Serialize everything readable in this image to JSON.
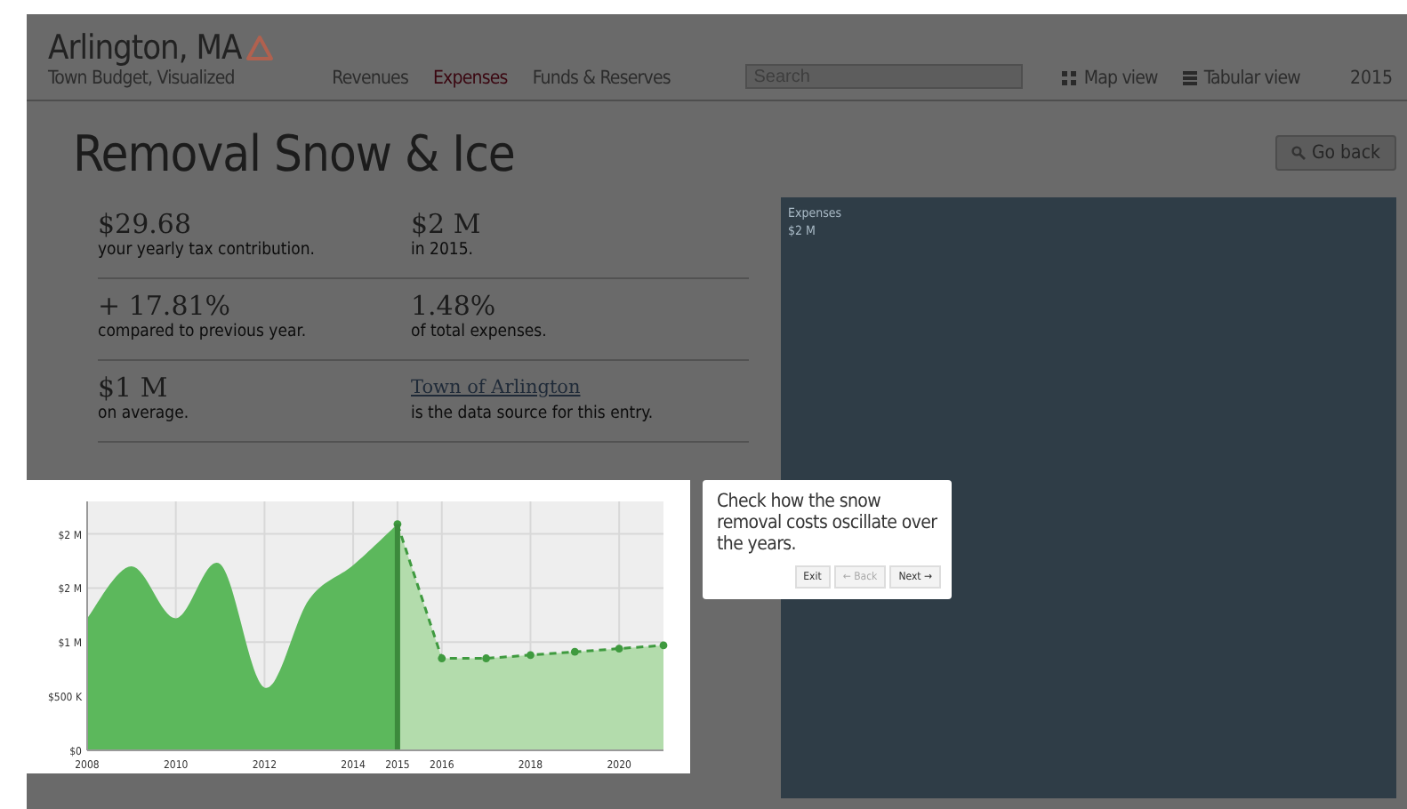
{
  "header": {
    "title": "Arlington, MA",
    "subtitle": "Town Budget, Visualized",
    "nav": [
      {
        "label": "Revenues",
        "selected": false
      },
      {
        "label": "Expenses",
        "selected": true
      },
      {
        "label": "Funds & Reserves",
        "selected": false
      }
    ],
    "search": {
      "placeholder": "Search"
    },
    "views": [
      {
        "label": "Map view",
        "kind": "map"
      },
      {
        "label": "Tabular view",
        "kind": "table"
      }
    ],
    "year": "2015"
  },
  "page_title": "Removal Snow & Ice",
  "go_back": "Go back",
  "stats": [
    {
      "value": "$29.68",
      "caption": "your yearly tax contribution."
    },
    {
      "value": "$2 M",
      "caption": "in 2015."
    },
    {
      "value": "+ 17.81%",
      "caption": "compared to previous year."
    },
    {
      "value": "1.48%",
      "caption": "of total expenses."
    },
    {
      "value": "$1 M",
      "caption": "on average."
    },
    {
      "link": "Town of Arlington",
      "caption": "is the data source for this entry."
    }
  ],
  "treemap": {
    "label": "Expenses",
    "value": "$2 M"
  },
  "chart": {
    "chart_data": {
      "type": "area",
      "x": [
        2008,
        2009,
        2010,
        2011,
        2012,
        2013,
        2014,
        2015,
        2016,
        2017,
        2018,
        2019,
        2020,
        2021
      ],
      "series": [
        {
          "color": "#5cb85c",
          "values": [
            1220000,
            1700000,
            1220000,
            1720000,
            580000,
            1390000,
            1710000,
            2090000,
            null,
            null,
            null,
            null,
            null,
            null
          ]
        },
        {
          "color": "#b3dcac",
          "values": [
            null,
            null,
            null,
            null,
            null,
            null,
            null,
            2090000,
            850000,
            850000,
            880000,
            910000,
            940000,
            970000
          ]
        }
      ],
      "xlim": [
        2008,
        2021
      ],
      "ylim": [
        0,
        2300000
      ],
      "xticks": [
        2008,
        2010,
        2012,
        2014,
        2015,
        2016,
        2018,
        2020
      ],
      "yticks": [
        {
          "value": 0,
          "label": "$0"
        },
        {
          "value": 500000,
          "label": "$500 K"
        },
        {
          "value": 1000000,
          "label": "$1 M"
        },
        {
          "value": 1500000,
          "label": "$2 M"
        },
        {
          "value": 2000000,
          "label": "$2 M"
        }
      ],
      "grid": true,
      "ref_lines": [
        {
          "axis": "x",
          "value": 2015,
          "color": "#3c8a3c"
        }
      ]
    }
  },
  "tour": {
    "text": "Check how the snow removal costs oscillate over the years.",
    "buttons": [
      {
        "label": "Exit",
        "disabled": false
      },
      {
        "label": "← Back",
        "disabled": true
      },
      {
        "label": "Next →",
        "disabled": false
      }
    ]
  }
}
